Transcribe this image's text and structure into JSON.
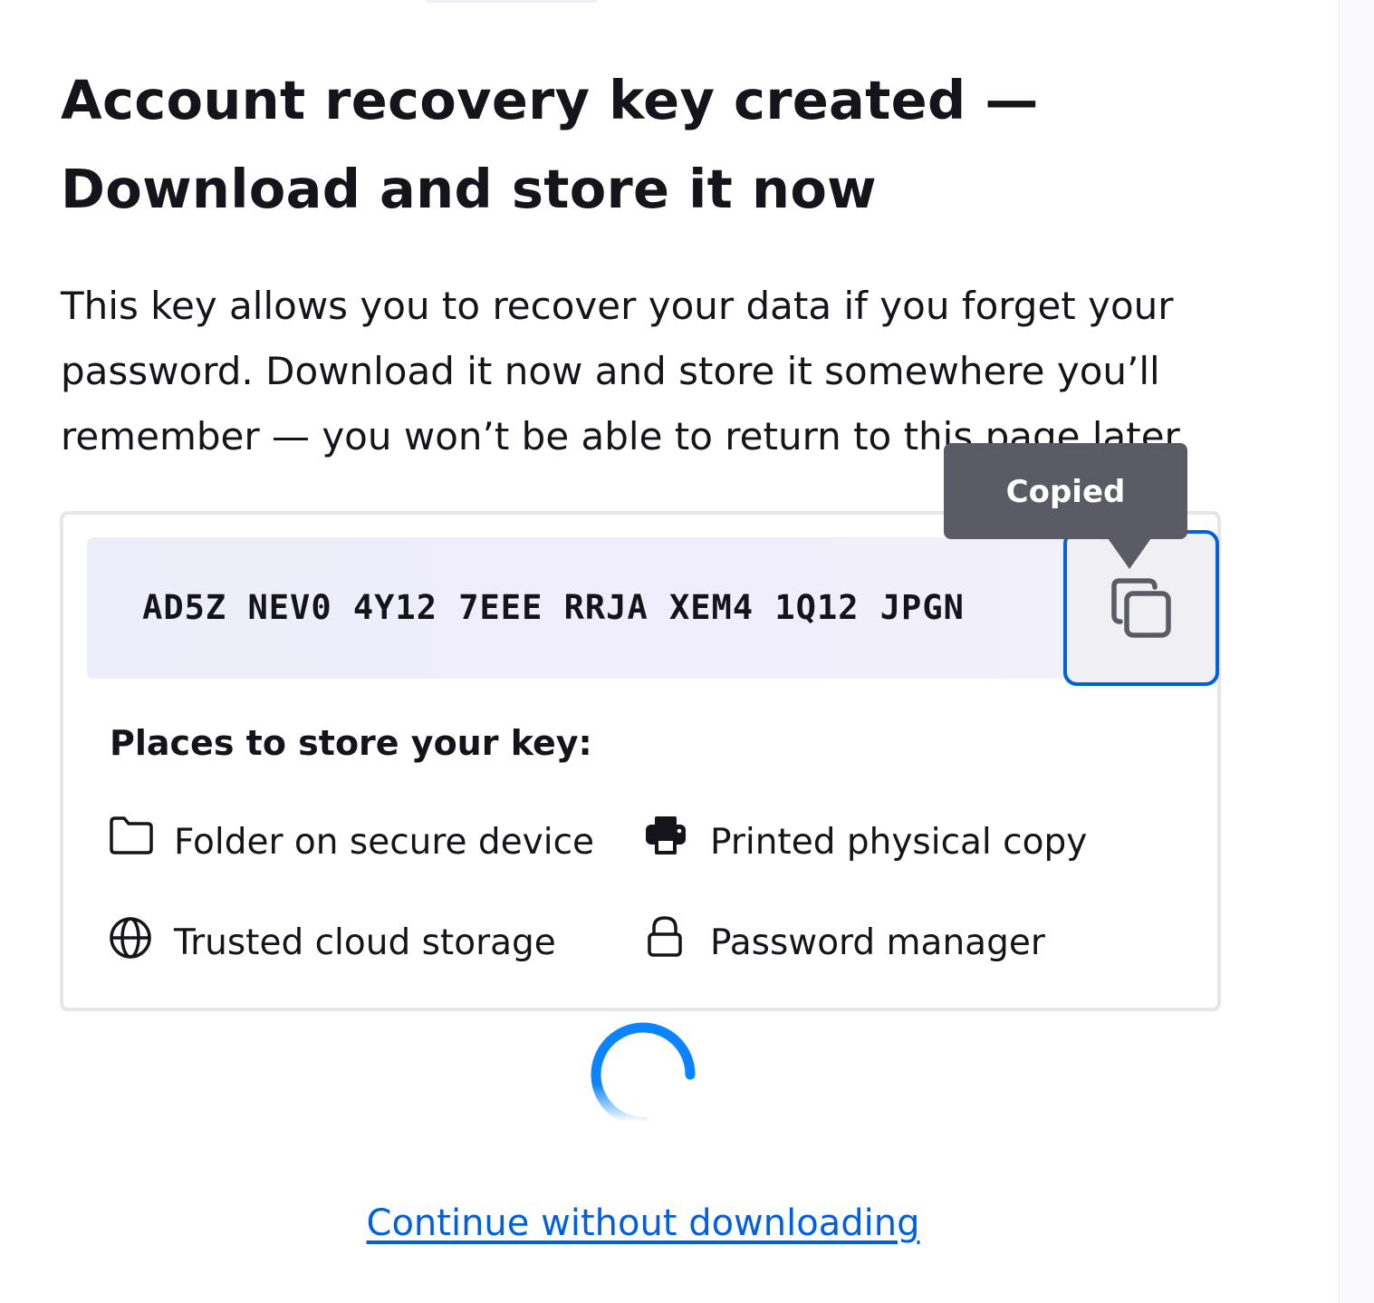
{
  "page": {
    "title": "Account recovery key created — Download and store it now",
    "description": "This key allows you to recover your data if you forget your password. Download it now and store it somewhere you’ll remember — you won’t be able to return to this page later."
  },
  "recovery_key": {
    "value": "AD5Z NEV0 4Y12 7EEE RRJA XEM4 1Q12 JPGN",
    "copy_icon": "copy-icon",
    "tooltip": "Copied"
  },
  "places": {
    "heading": "Places to store your key:",
    "items": [
      {
        "icon": "folder-icon",
        "label": "Folder on secure device"
      },
      {
        "icon": "printer-icon",
        "label": "Printed physical copy"
      },
      {
        "icon": "globe-icon",
        "label": "Trusted cloud storage"
      },
      {
        "icon": "lock-icon",
        "label": "Password manager"
      }
    ]
  },
  "loading": {
    "icon": "spinner-icon"
  },
  "actions": {
    "continue_label": "Continue without downloading"
  },
  "colors": {
    "accent": "#0060df",
    "tooltip_bg": "#5b5b66",
    "text": "#15141a",
    "spinner": "#0a84ff"
  }
}
